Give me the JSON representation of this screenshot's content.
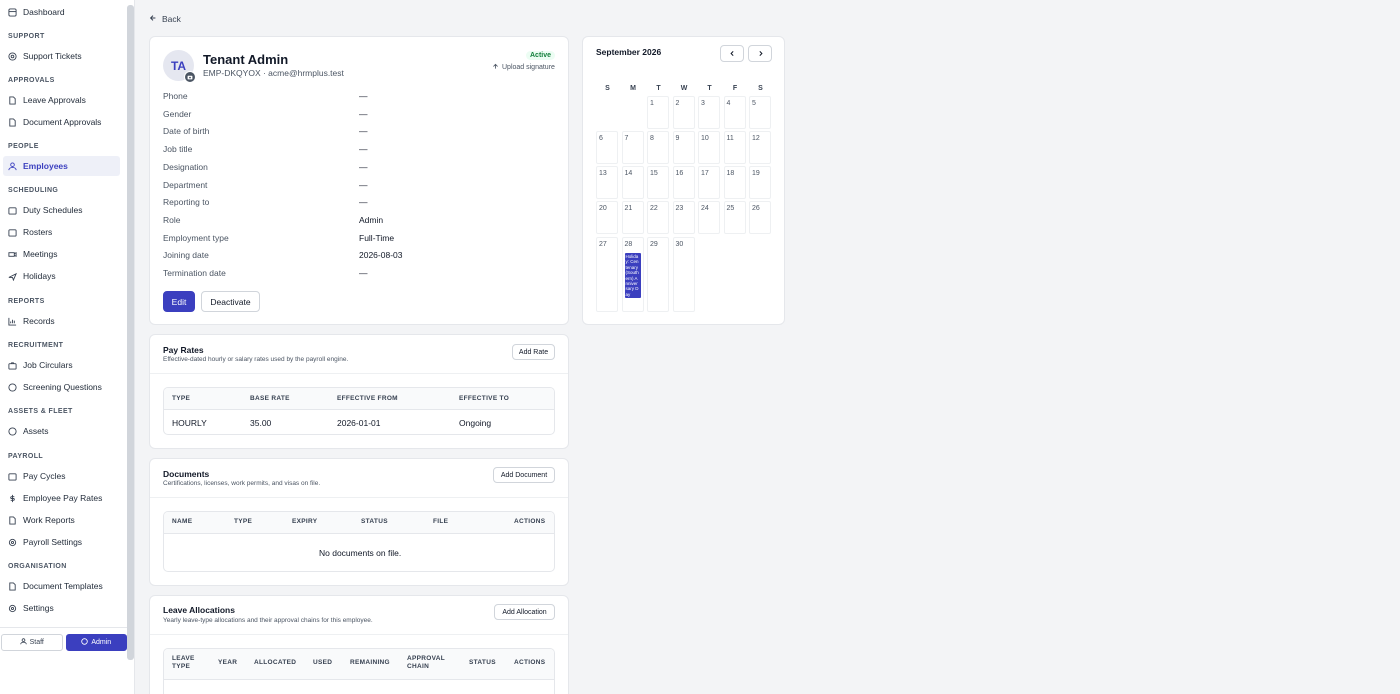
{
  "sidebar": {
    "dashboard": "Dashboard",
    "sections": {
      "support": "SUPPORT",
      "approvals": "APPROVALS",
      "people": "PEOPLE",
      "scheduling": "SCHEDULING",
      "reports": "REPORTS",
      "recruitment": "RECRUITMENT",
      "assets": "ASSETS & FLEET",
      "payroll": "PAYROLL",
      "organisation": "ORGANISATION"
    },
    "items": {
      "support_tickets": "Support Tickets",
      "leave_approvals": "Leave Approvals",
      "document_approvals": "Document Approvals",
      "employees": "Employees",
      "duty_schedules": "Duty Schedules",
      "rosters": "Rosters",
      "meetings": "Meetings",
      "holidays": "Holidays",
      "records": "Records",
      "job_circulars": "Job Circulars",
      "screening_questions": "Screening Questions",
      "assets": "Assets",
      "pay_cycles": "Pay Cycles",
      "employee_pay_rates": "Employee Pay Rates",
      "work_reports": "Work Reports",
      "payroll_settings": "Payroll Settings",
      "document_templates": "Document Templates",
      "settings": "Settings"
    },
    "bottom": {
      "staff": "Staff",
      "admin": "Admin"
    }
  },
  "back_label": "Back",
  "profile": {
    "initials": "TA",
    "name": "Tenant Admin",
    "subtitle": "EMP-DKQYOX · acme@hrmplus.test",
    "status": "Active",
    "upload_signature": "Upload signature",
    "fields": [
      {
        "label": "Phone",
        "value": "—"
      },
      {
        "label": "Gender",
        "value": "—"
      },
      {
        "label": "Date of birth",
        "value": "—"
      },
      {
        "label": "Job title",
        "value": "—"
      },
      {
        "label": "Designation",
        "value": "—"
      },
      {
        "label": "Department",
        "value": "—"
      },
      {
        "label": "Reporting to",
        "value": "—"
      },
      {
        "label": "Role",
        "value": "Admin"
      },
      {
        "label": "Employment type",
        "value": "Full-Time"
      },
      {
        "label": "Joining date",
        "value": "2026-08-03"
      },
      {
        "label": "Termination date",
        "value": "—"
      }
    ],
    "edit_label": "Edit",
    "deactivate_label": "Deactivate"
  },
  "calendar": {
    "month_label": "September 2026",
    "dow": [
      "S",
      "M",
      "T",
      "W",
      "T",
      "F",
      "S"
    ],
    "holiday_text": "Holiday: Centenary (Southern) Anniversary Day"
  },
  "pay_rates": {
    "title": "Pay Rates",
    "description": "Effective-dated hourly or salary rates used by the payroll engine.",
    "add_label": "Add Rate",
    "headers": {
      "type": "TYPE",
      "base_rate": "BASE RATE",
      "effective_from": "EFFECTIVE FROM",
      "effective_to": "EFFECTIVE TO"
    },
    "row": {
      "type": "HOURLY",
      "base_rate": "35.00",
      "effective_from": "2026-01-01",
      "effective_to": "Ongoing"
    }
  },
  "documents": {
    "title": "Documents",
    "description": "Certifications, licenses, work permits, and visas on file.",
    "add_label": "Add Document",
    "headers": {
      "name": "NAME",
      "type": "TYPE",
      "expiry": "EXPIRY",
      "status": "STATUS",
      "file": "FILE",
      "actions": "ACTIONS"
    },
    "empty": "No documents on file."
  },
  "leave_allocations": {
    "title": "Leave Allocations",
    "description": "Yearly leave-type allocations and their approval chains for this employee.",
    "add_label": "Add Allocation",
    "headers": {
      "leave_type": "LEAVE TYPE",
      "year": "YEAR",
      "allocated": "ALLOCATED",
      "used": "USED",
      "remaining": "REMAINING",
      "approval_chain": "APPROVAL CHAIN",
      "status": "STATUS",
      "actions": "ACTIONS"
    }
  },
  "colors": {
    "accent": "#3b3fbf",
    "active": "#15803d"
  }
}
